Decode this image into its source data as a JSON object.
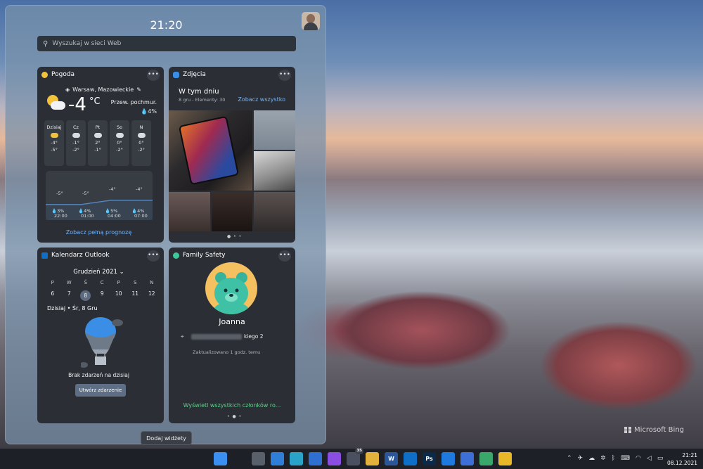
{
  "panel": {
    "time": "21:20",
    "search_placeholder": "Wyszukaj w sieci Web",
    "add_widgets": "Dodaj widżety"
  },
  "weather": {
    "title": "Pogoda",
    "location": "Warsaw, Mazowieckie",
    "temp": "-4",
    "unit": "°C",
    "condition": "Przew. pochmur.",
    "precip": "4%",
    "days": [
      {
        "name": "Dzisiaj",
        "high": "-4°",
        "low": "-5°"
      },
      {
        "name": "Cz",
        "high": "-1°",
        "low": "-2°"
      },
      {
        "name": "Pt",
        "high": "2°",
        "low": "-1°"
      },
      {
        "name": "So",
        "high": "0°",
        "low": "-2°"
      },
      {
        "name": "N",
        "high": "0°",
        "low": "-2°"
      }
    ],
    "hourly": [
      {
        "time": "22:00",
        "temp": "-5°",
        "rain": "3%"
      },
      {
        "time": "01:00",
        "temp": "-5°",
        "rain": "4%"
      },
      {
        "time": "04:00",
        "temp": "-4°",
        "rain": "5%"
      },
      {
        "time": "07:00",
        "temp": "-4°",
        "rain": "4%"
      }
    ],
    "link": "Zobacz pełną prognozę"
  },
  "photos": {
    "title": "Zdjęcia",
    "heading": "W tym dniu",
    "subtitle": "8 gru - Elementy: 30",
    "link": "Zobacz wszystko"
  },
  "calendar": {
    "title": "Kalendarz Outlook",
    "month": "Grudzień 2021",
    "weekdays": [
      "P",
      "W",
      "Ś",
      "C",
      "P",
      "S",
      "N"
    ],
    "dates": [
      "6",
      "7",
      "8",
      "9",
      "10",
      "11",
      "12"
    ],
    "today": "Dzisiaj • Śr, 8 Gru",
    "empty": "Brak zdarzeń na dzisiaj",
    "button": "Utwórz zdarzenie"
  },
  "family": {
    "title": "Family Safety",
    "name": "Joanna",
    "address_suffix": "kiego 2",
    "updated": "Zaktualizowano 1 godz. temu",
    "link": "Wyświetl wszystkich członków ro..."
  },
  "wallpaper": {
    "credit": "Microsoft Bing"
  },
  "taskbar": {
    "apps": [
      {
        "name": "start-icon",
        "glyph": "",
        "color": "#3b8ff0"
      },
      {
        "name": "search-icon",
        "glyph": "",
        "color": "#1d2026"
      },
      {
        "name": "task-view-icon",
        "glyph": "",
        "color": "#5a606a"
      },
      {
        "name": "widgets-icon",
        "glyph": "",
        "color": "#2f7fd8"
      },
      {
        "name": "edge-icon",
        "glyph": "",
        "color": "#2aa3c9"
      },
      {
        "name": "mail-icon",
        "glyph": "",
        "color": "#2f6fd0"
      },
      {
        "name": "messenger-icon",
        "glyph": "",
        "color": "#8a4fe0"
      },
      {
        "name": "chat-icon",
        "glyph": "",
        "color": "#4a5060",
        "badge": "35"
      },
      {
        "name": "slack-icon",
        "glyph": "",
        "color": "#e3b23c"
      },
      {
        "name": "word-icon",
        "glyph": "W",
        "color": "#2b579a"
      },
      {
        "name": "outlook-icon",
        "glyph": "",
        "color": "#0f6fc6"
      },
      {
        "name": "photoshop-icon",
        "glyph": "Ps",
        "color": "#0b2a4a"
      },
      {
        "name": "trello-icon",
        "glyph": "",
        "color": "#1f7ae0"
      },
      {
        "name": "translator-icon",
        "glyph": "",
        "color": "#3d6fd6"
      },
      {
        "name": "maps-icon",
        "glyph": "",
        "color": "#3aa86a"
      },
      {
        "name": "file-explorer-icon",
        "glyph": "",
        "color": "#e8b828"
      }
    ],
    "time": "21:21",
    "date": "08.12.2021"
  }
}
